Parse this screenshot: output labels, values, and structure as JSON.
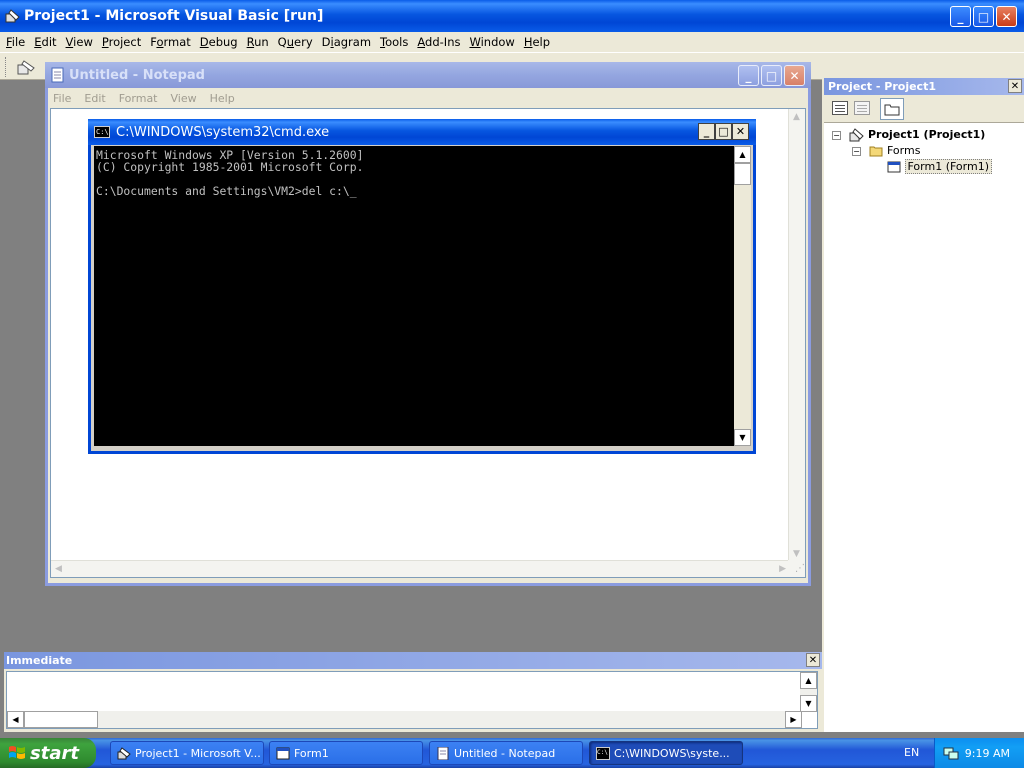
{
  "vb": {
    "title": "Project1 - Microsoft Visual Basic [run]",
    "menu": [
      {
        "u": "F",
        "rest": "ile"
      },
      {
        "u": "E",
        "rest": "dit"
      },
      {
        "u": "V",
        "rest": "iew"
      },
      {
        "u": "P",
        "rest": "roject"
      },
      {
        "pre": "F",
        "u": "o",
        "rest": "rmat"
      },
      {
        "u": "D",
        "rest": "ebug"
      },
      {
        "u": "R",
        "rest": "un"
      },
      {
        "pre": "Q",
        "u": "u",
        "rest": "ery"
      },
      {
        "pre": "D",
        "u": "i",
        "rest": "agram"
      },
      {
        "u": "T",
        "rest": "ools"
      },
      {
        "u": "A",
        "rest": "dd-Ins"
      },
      {
        "u": "W",
        "rest": "indow"
      },
      {
        "u": "H",
        "rest": "elp"
      }
    ]
  },
  "notepad": {
    "title": "Untitled - Notepad",
    "menu": [
      "File",
      "Edit",
      "Format",
      "View",
      "Help"
    ]
  },
  "cmd": {
    "title": "C:\\WINDOWS\\system32\\cmd.exe",
    "lines": [
      "Microsoft Windows XP [Version 5.1.2600]",
      "(C) Copyright 1985-2001 Microsoft Corp.",
      "",
      "C:\\Documents and Settings\\VM2>del c:\\_"
    ]
  },
  "project": {
    "header": "Project - Project1",
    "root": "Project1 (Project1)",
    "folder": "Forms",
    "item": "Form1 (Form1)"
  },
  "immediate": {
    "header": "Immediate"
  },
  "taskbar": {
    "start": "start",
    "tasks": [
      {
        "label": "Project1 - Microsoft V..."
      },
      {
        "label": "Form1"
      },
      {
        "label": "Untitled - Notepad"
      },
      {
        "label": "C:\\WINDOWS\\syste..."
      }
    ],
    "lang": "EN",
    "time": "9:19 AM"
  }
}
